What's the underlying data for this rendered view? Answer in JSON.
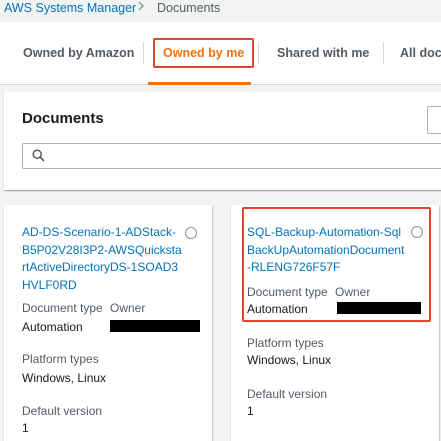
{
  "breadcrumb": {
    "parent": "AWS Systems Manager",
    "current": "Documents"
  },
  "tabs": [
    {
      "label": "Owned by Amazon",
      "active": false
    },
    {
      "label": "Owned by me",
      "active": true
    },
    {
      "label": "Shared with me",
      "active": false
    },
    {
      "label": "All docu",
      "active": false
    }
  ],
  "panel": {
    "title": "Documents",
    "search_value": ""
  },
  "labels": {
    "document_type": "Document type",
    "owner": "Owner",
    "platform_types": "Platform types",
    "default_version": "Default version"
  },
  "documents": [
    {
      "name": "AD-DS-Scenario-1-ADStack-B5P02V28I3P2-AWSQuickstartActiveDirectoryDS-1SOAD3HVLF0RD",
      "document_type": "Automation",
      "platform_types": "Windows, Linux",
      "default_version": "1"
    },
    {
      "name": "SQL-Backup-Automation-SqlBackUpAutomationDocument-RLENG726F57F",
      "document_type": "Automation",
      "platform_types": "Windows, Linux",
      "default_version": "1"
    }
  ],
  "colors": {
    "link": "#0073bb",
    "active_tab": "#ec7211",
    "highlight": "#e0452c",
    "redaction": "#000000"
  },
  "icons": {
    "breadcrumb_separator": "chevron-right-icon",
    "search": "search-icon"
  }
}
